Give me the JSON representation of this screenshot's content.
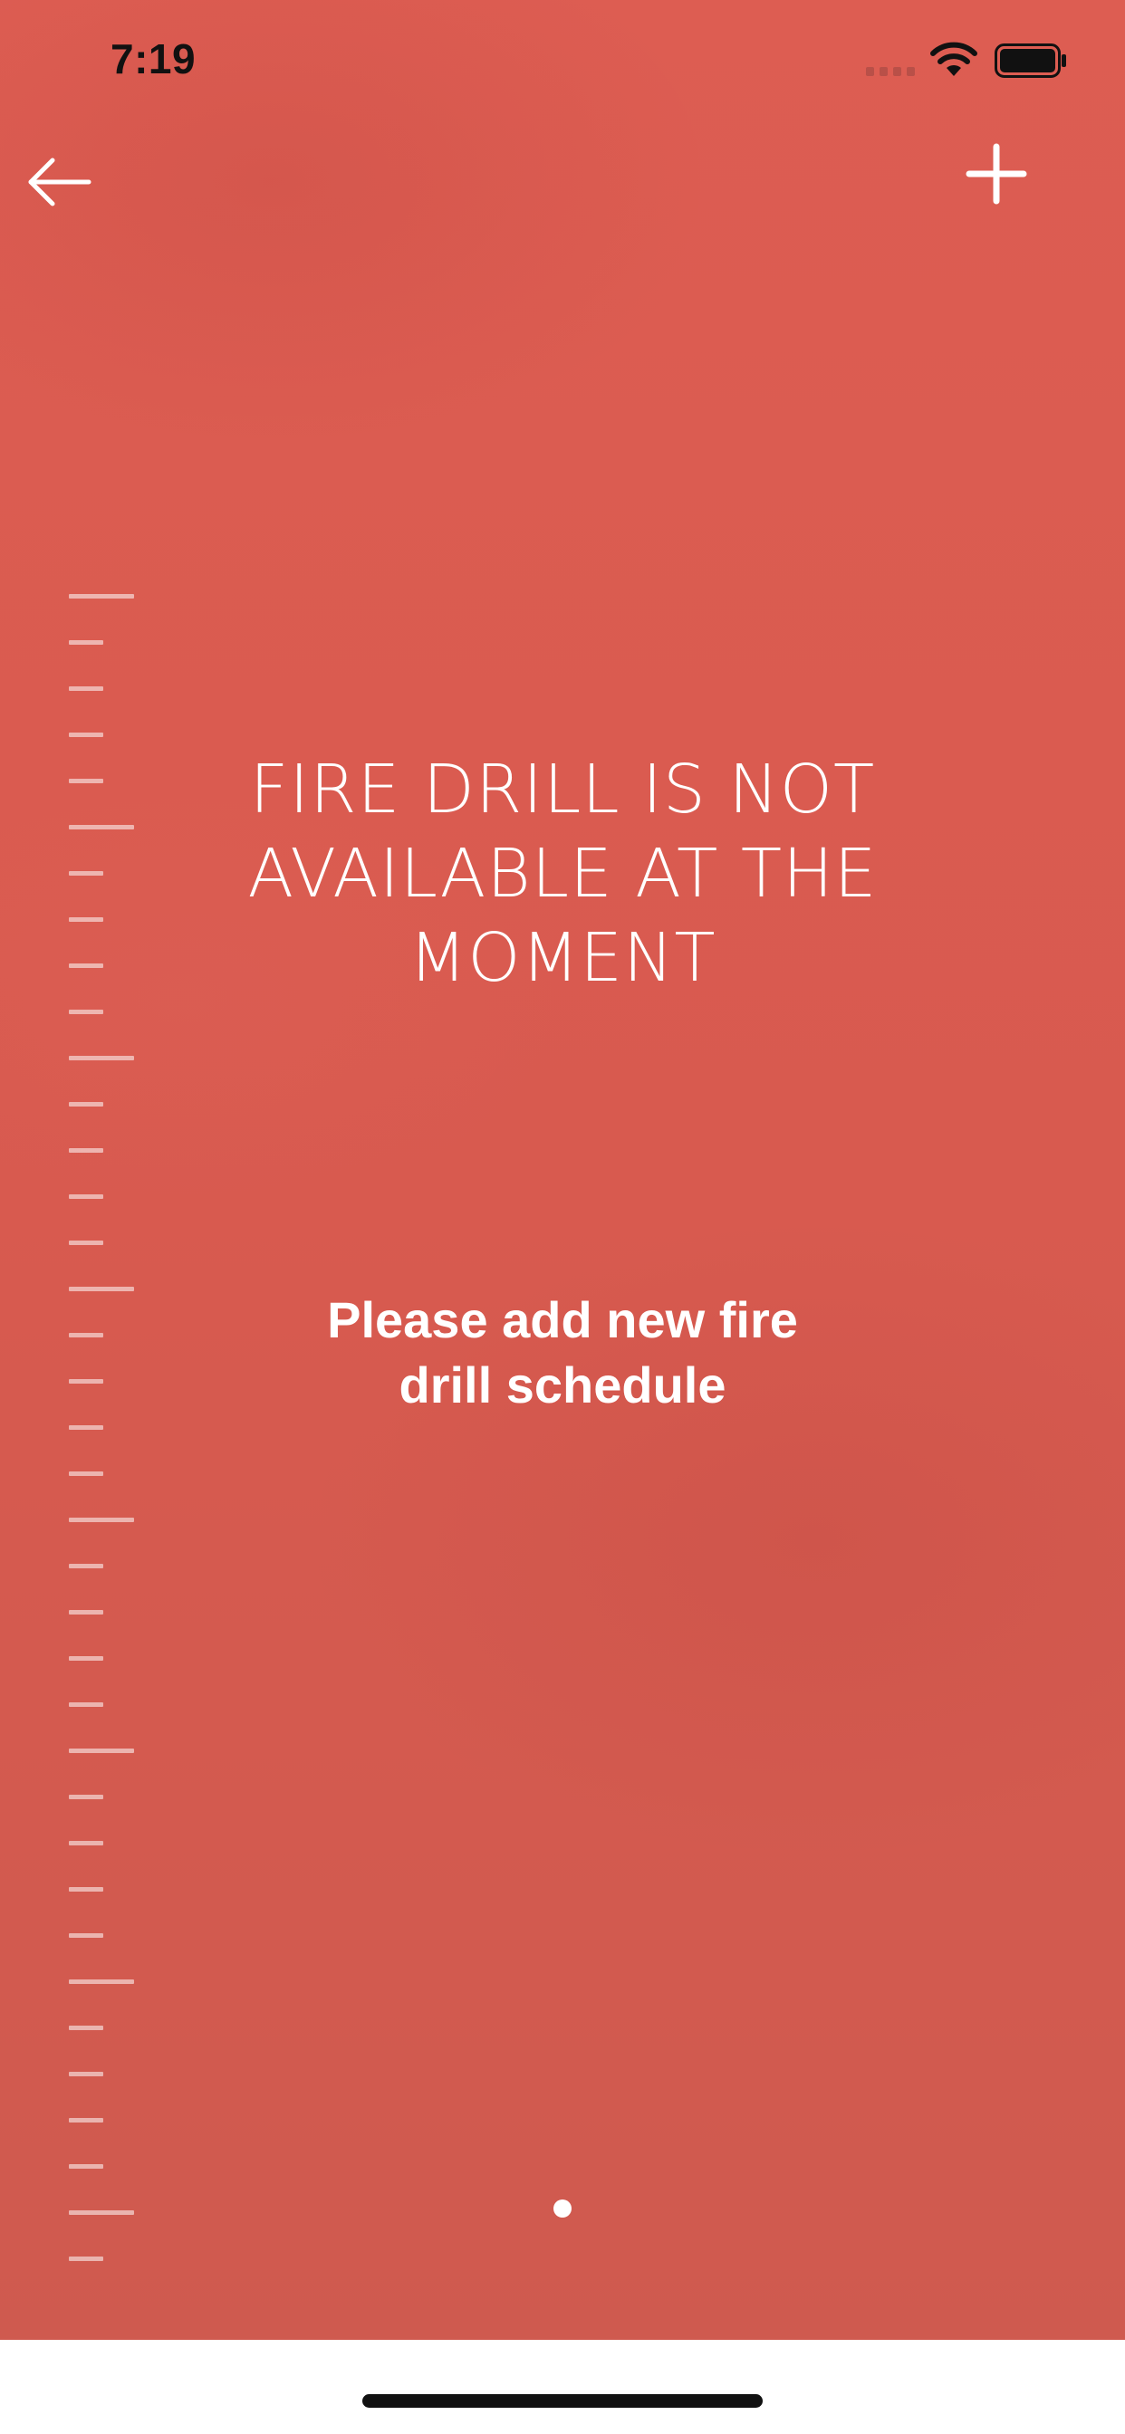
{
  "status_bar": {
    "time": "7:19",
    "icons": [
      "signal-icon",
      "wifi-icon",
      "battery-icon"
    ]
  },
  "nav": {
    "back_icon": "arrow-left-icon",
    "add_icon": "plus-icon"
  },
  "main": {
    "headline": "FIRE DRILL IS NOT AVAILABLE AT THE MOMENT",
    "message": "Please add new fire drill schedule"
  },
  "pager": {
    "page_count": 1,
    "current_page": 1
  },
  "colors": {
    "background": "#d95b50",
    "text": "#ffffff",
    "status_text": "#111111"
  }
}
